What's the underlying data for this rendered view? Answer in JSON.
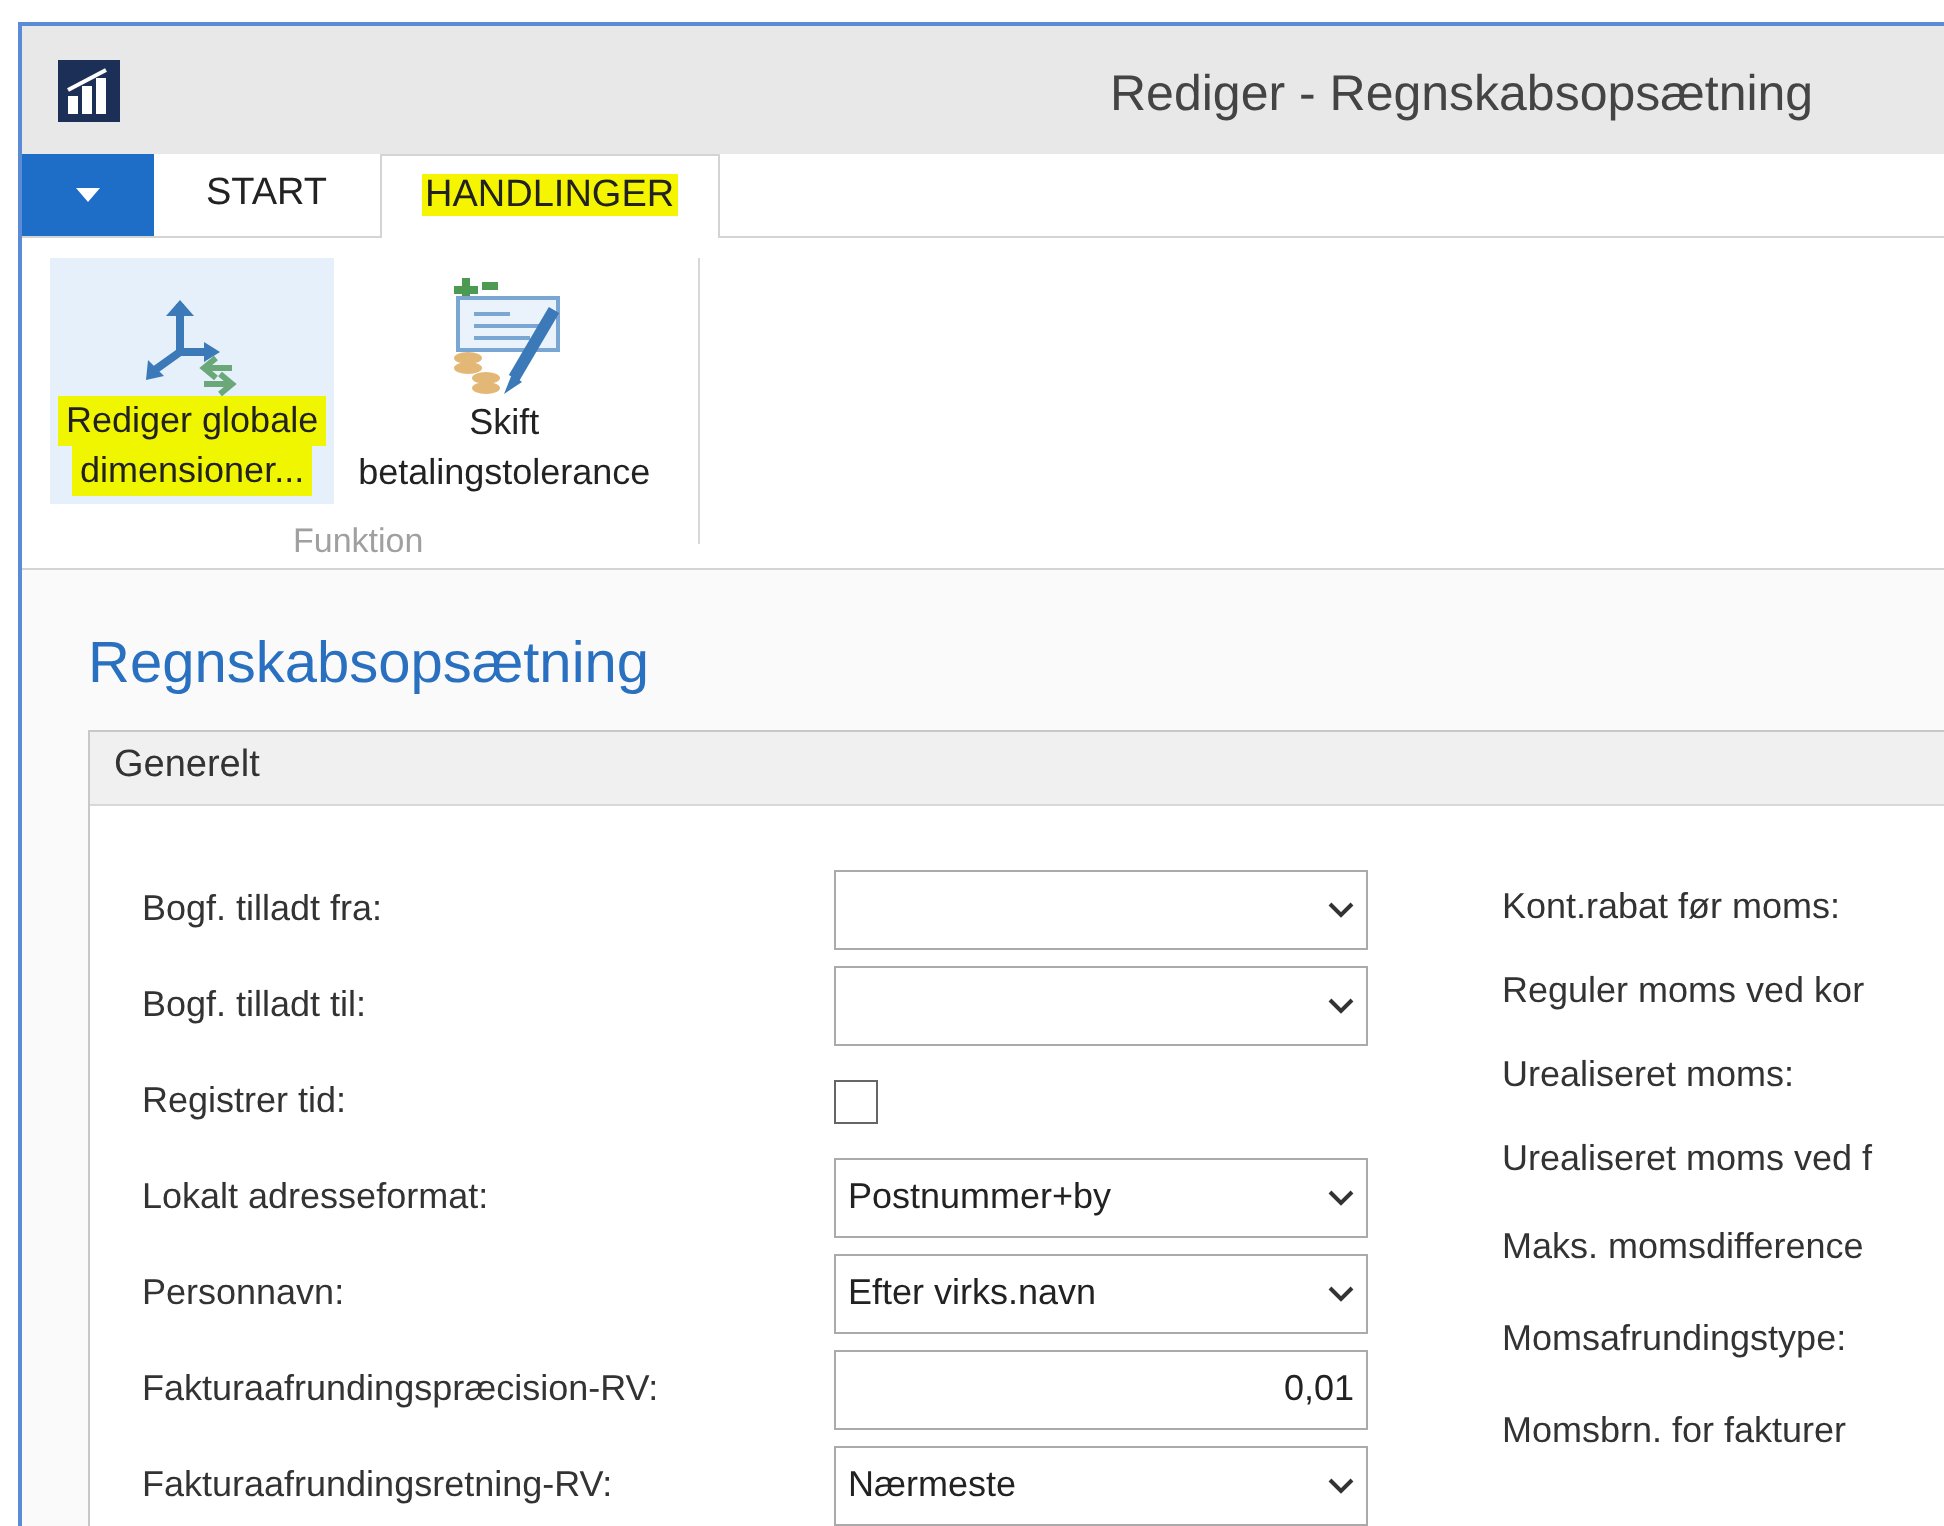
{
  "window": {
    "title": "Rediger - Regnskabsopsætning"
  },
  "tabs": [
    {
      "label": "START",
      "selected": false,
      "highlighted": false
    },
    {
      "label": "HANDLINGER",
      "selected": true,
      "highlighted": true
    }
  ],
  "ribbon": {
    "groups": [
      {
        "label": "Funktion",
        "actions": [
          {
            "kind": "dimensions",
            "label_lines": [
              "Rediger globale",
              "dimensioner..."
            ],
            "selected": true,
            "highlighted": true
          },
          {
            "kind": "tolerance",
            "label_lines": [
              "Skift",
              "betalingstolerance"
            ],
            "selected": false,
            "highlighted": false
          }
        ]
      }
    ]
  },
  "page": {
    "heading": "Regnskabsopsætning"
  },
  "section": {
    "title": "Generelt",
    "left_fields": [
      {
        "label": "Bogf. tilladt fra:",
        "kind": "dropdown"
      },
      {
        "label": "Bogf. tilladt til:",
        "kind": "dropdown"
      },
      {
        "label": "Registrer tid:",
        "kind": "checkbox",
        "checked": false
      },
      {
        "label": "Lokalt adresseformat:",
        "kind": "dropdown",
        "value": "Postnummer+by"
      },
      {
        "label": "Personnavn:",
        "kind": "dropdown",
        "value": "Efter virks.navn"
      },
      {
        "label": "Fakturaafrundingspræcision-RV:",
        "kind": "number",
        "value": "0,01"
      },
      {
        "label": "Fakturaafrundingsretning-RV:",
        "kind": "dropdown",
        "value": "Nærmeste"
      }
    ],
    "right_labels": [
      "Kont.rabat før moms:",
      "Reguler moms ved kor",
      "Urealiseret moms:",
      "Urealiseret moms ved f",
      "Maks. momsdifference",
      "Momsafrundingstype:",
      "Momsbrn. for fakturer"
    ]
  }
}
